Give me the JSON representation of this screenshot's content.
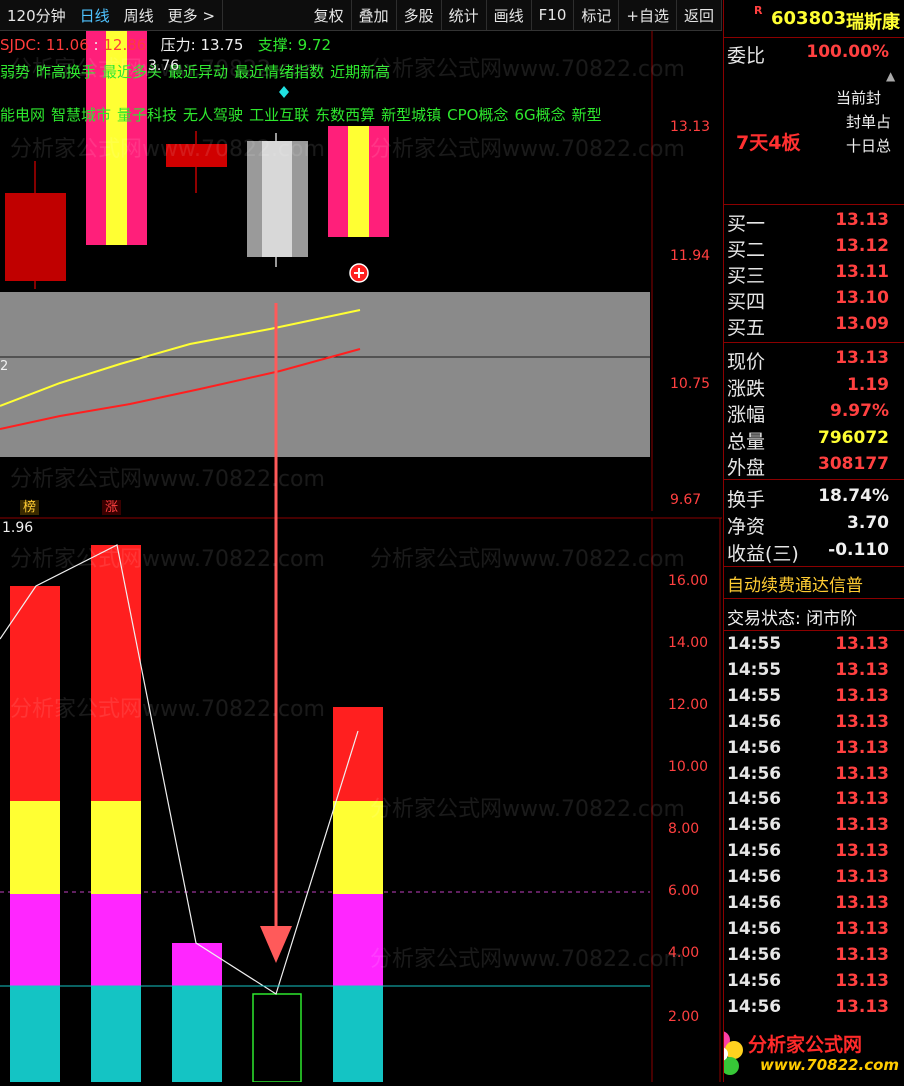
{
  "toolbar": {
    "items": [
      {
        "label": "120分钟",
        "active": false
      },
      {
        "label": "日线",
        "active": true
      },
      {
        "label": "周线",
        "active": false
      },
      {
        "label": "更多 >",
        "active": false
      },
      {
        "label": "复权",
        "active": false
      },
      {
        "label": "叠加",
        "active": false
      },
      {
        "label": "多股",
        "active": false
      },
      {
        "label": "统计",
        "active": false
      },
      {
        "label": "画线",
        "active": false
      },
      {
        "label": "F10",
        "active": false
      },
      {
        "label": "标记",
        "active": false
      },
      {
        "label": "+自选",
        "active": false
      },
      {
        "label": "返回",
        "active": false
      }
    ]
  },
  "indicator": {
    "name": "SJDC:",
    "v1": "11.06",
    "v2": "12.86",
    "pressure_label": "压力:",
    "pressure": "13.75",
    "support_label": "支撑:",
    "support": "9.72"
  },
  "tags_line1": [
    "弱势",
    "昨高换手",
    "最近多头",
    "最近异动",
    "最近情绪指数",
    "近期新高"
  ],
  "tags_line2": [
    "能电网",
    "智慧城市",
    "量子科技",
    "无人驾驶",
    "工业互联",
    "东数西算",
    "新型城镇",
    "CPO概念",
    "6G概念",
    "新型"
  ],
  "price_axis": [
    "13.13",
    "11.94",
    "10.75",
    "9.67"
  ],
  "overlay_text": "3.76",
  "ma_label_left": "2",
  "rank_tags": [
    {
      "text": "榜",
      "color": "#ffcc33"
    },
    {
      "text": "涨",
      "color": "#ff4040"
    }
  ],
  "lower_value": "1.96",
  "lower_axis": [
    "16.00",
    "14.00",
    "12.00",
    "10.00",
    "8.00",
    "6.00",
    "4.00",
    "2.00"
  ],
  "watermark": "分析家公式网www.70822.com",
  "logo": {
    "name": "分析家公式网",
    "url": "www.70822.com"
  },
  "colors": {
    "bull": "#ff1f1f",
    "bear": "#ff1f7a",
    "yellow": "#ffff33",
    "magenta": "#ff26ff",
    "cyan": "#14c4c4",
    "axis": "#ff4040"
  },
  "panel": {
    "code": "603803",
    "name": "瑞斯康",
    "r_mark": "R",
    "webi_label": "委比",
    "webi": "100.00%",
    "notes": [
      "当前封",
      "封单占",
      "十日总"
    ],
    "streak": "7天4板",
    "bids": [
      {
        "label": "买一",
        "price": "13.13"
      },
      {
        "label": "买二",
        "price": "13.12"
      },
      {
        "label": "买三",
        "price": "13.11"
      },
      {
        "label": "买四",
        "price": "13.10"
      },
      {
        "label": "买五",
        "price": "13.09"
      }
    ],
    "quote": [
      {
        "label": "现价",
        "value": "13.13",
        "color": "#ff4040"
      },
      {
        "label": "涨跌",
        "value": "1.19",
        "color": "#ff4040"
      },
      {
        "label": "涨幅",
        "value": "9.97%",
        "color": "#ff4040"
      },
      {
        "label": "总量",
        "value": "796072",
        "color": "#ffff33"
      },
      {
        "label": "外盘",
        "value": "308177",
        "color": "#ff4040"
      }
    ],
    "fin": [
      {
        "label": "换手",
        "value": "18.74%",
        "color": "#f0f0f0"
      },
      {
        "label": "净资",
        "value": "3.70",
        "color": "#f0f0f0"
      },
      {
        "label": "收益(三)",
        "value": "-0.110",
        "color": "#f0f0f0"
      }
    ],
    "promo": "自动续费通达信普",
    "trade_status": "交易状态: 闭市阶",
    "ticks": [
      {
        "time": "14:55",
        "price": "13.13"
      },
      {
        "time": "14:55",
        "price": "13.13"
      },
      {
        "time": "14:55",
        "price": "13.13"
      },
      {
        "time": "14:56",
        "price": "13.13"
      },
      {
        "time": "14:56",
        "price": "13.13"
      },
      {
        "time": "14:56",
        "price": "13.13"
      },
      {
        "time": "14:56",
        "price": "13.13"
      },
      {
        "time": "14:56",
        "price": "13.13"
      },
      {
        "time": "14:56",
        "price": "13.13"
      },
      {
        "time": "14:56",
        "price": "13.13"
      },
      {
        "time": "14:56",
        "price": "13.13"
      },
      {
        "time": "14:56",
        "price": "13.13"
      },
      {
        "time": "14:56",
        "price": "13.13"
      },
      {
        "time": "14:56",
        "price": "13.13"
      },
      {
        "time": "14:56",
        "price": "13.13"
      }
    ]
  }
}
